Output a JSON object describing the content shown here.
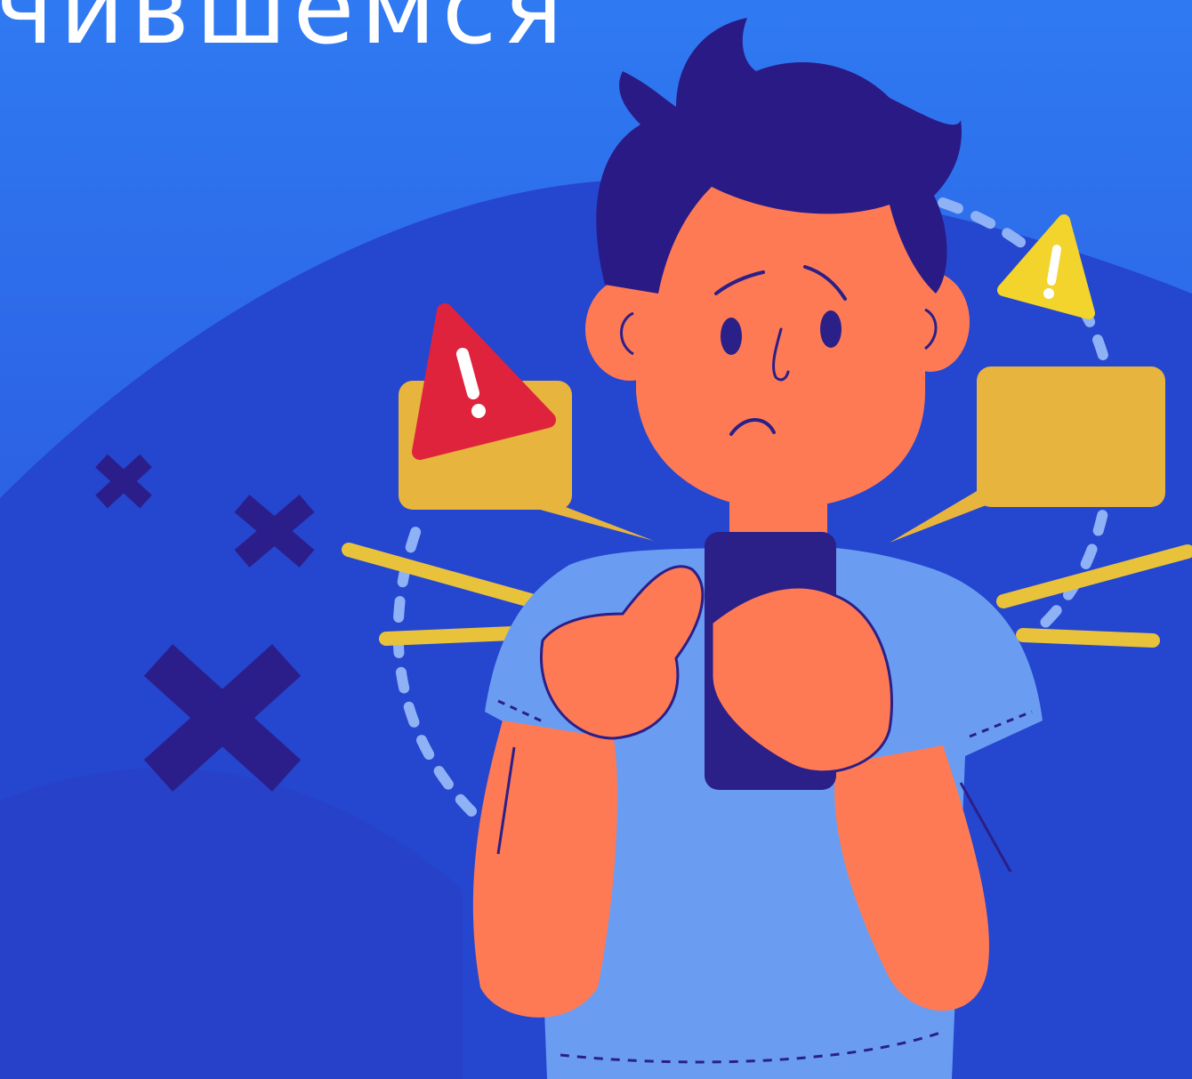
{
  "headline": {
    "text": "чившемся"
  },
  "colors": {
    "background_top": "#2f7af2",
    "background_bottom": "#3550d6",
    "blob": "#2546cf",
    "hair": "#2a1a86",
    "skin": "#fe7a55",
    "shirt": "#6a9df2",
    "phone": "#2b1f88",
    "alert_red": "#e0233d",
    "alert_yellow": "#f2d42c",
    "bubble": "#e7b43e",
    "headline_text": "#ffffff"
  },
  "icons": [
    "alert-triangle-red-icon",
    "alert-triangle-yellow-icon",
    "cross-mark-icon",
    "speech-bubble-icon"
  ]
}
